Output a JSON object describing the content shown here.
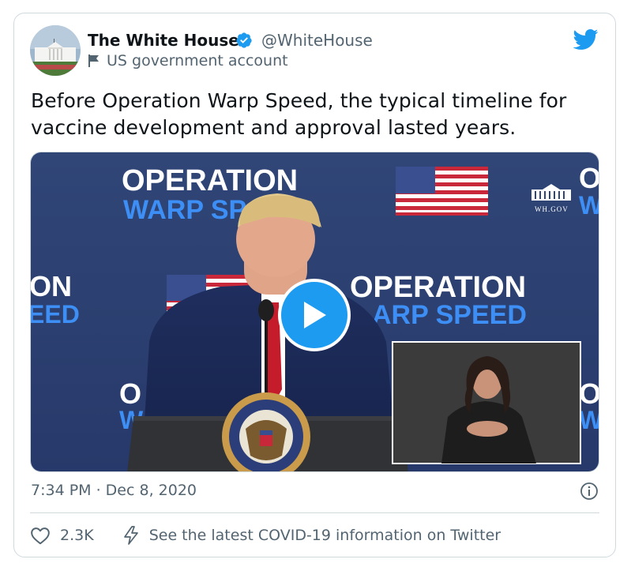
{
  "account": {
    "name": "The White House",
    "handle": "@WhiteHouse",
    "label": "US government account"
  },
  "tweet": {
    "text": "Before Operation Warp Speed, the typical timeline for vaccine development and approval lasted years.",
    "timestamp": "7:34 PM · Dec 8, 2020"
  },
  "video": {
    "backdrop_text_line1": "OPERATION",
    "backdrop_text_line2": "WARP SPEED",
    "backdrop_partial_left_1": "ON",
    "backdrop_partial_left_2": "EED",
    "backdrop_partial_center_2": "ARP SPEED",
    "backdrop_partial_top_2": "WARP SP",
    "backdrop_partial_edge_1": "O",
    "backdrop_partial_edge_2": "W",
    "seal_logo_text": "WH.GOV",
    "seal_text": "PRESIDENT OF THE UNITED STATES"
  },
  "actions": {
    "like_count": "2.3K",
    "covid_link": "See the latest COVID-19 information on Twitter"
  },
  "colors": {
    "twitter_blue": "#1d9bf0",
    "secondary_text": "#536471",
    "backdrop_navy": "#2b3f73",
    "backdrop_title_white": "#ffffff",
    "backdrop_title_blue": "#3d8ff5"
  }
}
